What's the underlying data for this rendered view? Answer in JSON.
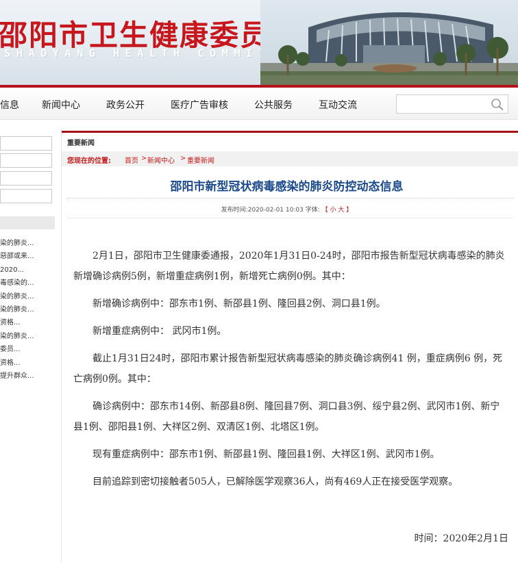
{
  "banner": {
    "title": "邵阳市卫生健康委员会",
    "subtitle": "SHAOYANG HEALTH COMMITTEE"
  },
  "nav": {
    "items": [
      "信息",
      "新闻中心",
      "政务公开",
      "医疗广告审核",
      "公共服务",
      "互动交流"
    ],
    "search_placeholder": ""
  },
  "sidebar": {
    "links": [
      "染的肺炎...",
      "惡邵或来...",
      "2020...",
      "毒感染的...",
      "染的肺炎...",
      "染的肺炎...",
      "资格...",
      "染的肺炎...",
      "委员...",
      "资格...",
      "提升群众..."
    ]
  },
  "main": {
    "section_title": "重要新闻",
    "breadcrumb": {
      "label": "您现在的位置:",
      "items": [
        "首页",
        "新闻中心",
        "重要新闻"
      ],
      "separator": ">"
    },
    "article": {
      "title": "邵阳市新型冠状病毒感染的肺炎防控动态信息",
      "meta": {
        "published_label": "发布时间:",
        "published": "2020-02-01 10:03",
        "font_label": "字体:",
        "bracket_open": "【",
        "small": "小",
        "large": "大",
        "bracket_close": "】"
      },
      "paragraphs": [
        "2月1日，邵阳市卫生健康委通报，2020年1月31日0-24时，邵阳市报告新型冠状病毒感染的肺炎新增确诊病例5例，新增重症病例1例，新增死亡病例0例。其中：",
        "新增确诊病例中：邵东市1例、新邵县1例、隆回县2例、洞口县1例。",
        "新增重症病例中： 武冈市1例。",
        "截止1月31日24时，邵阳市累计报告新型冠状病毒感染的肺炎确诊病例41 例，重症病例6 例，死亡病例0例。其中：",
        "确诊病例中：邵东市14例、新邵县8例、隆回县7例、洞口县3例、绥宁县2例、武冈市1例、新宁县1例、邵阳县1例、大祥区2例、双清区1例、北塔区1例。",
        "现有重症病例中：邵东市1例、新邵县1例、隆回县1例、大祥区1例、武冈市1例。",
        "目前追踪到密切接触者505人，已解除医学观察36人，尚有469人正在接受医学观察。"
      ],
      "date_line": "时间：2020年2月1日"
    },
    "share_colors": [
      "#5aa0d8",
      "#e8a33a",
      "#3a7fc6",
      "#5ab55a"
    ]
  },
  "colors": {
    "brand_red": "#c8161d",
    "title_blue": "#1b4a8c"
  }
}
